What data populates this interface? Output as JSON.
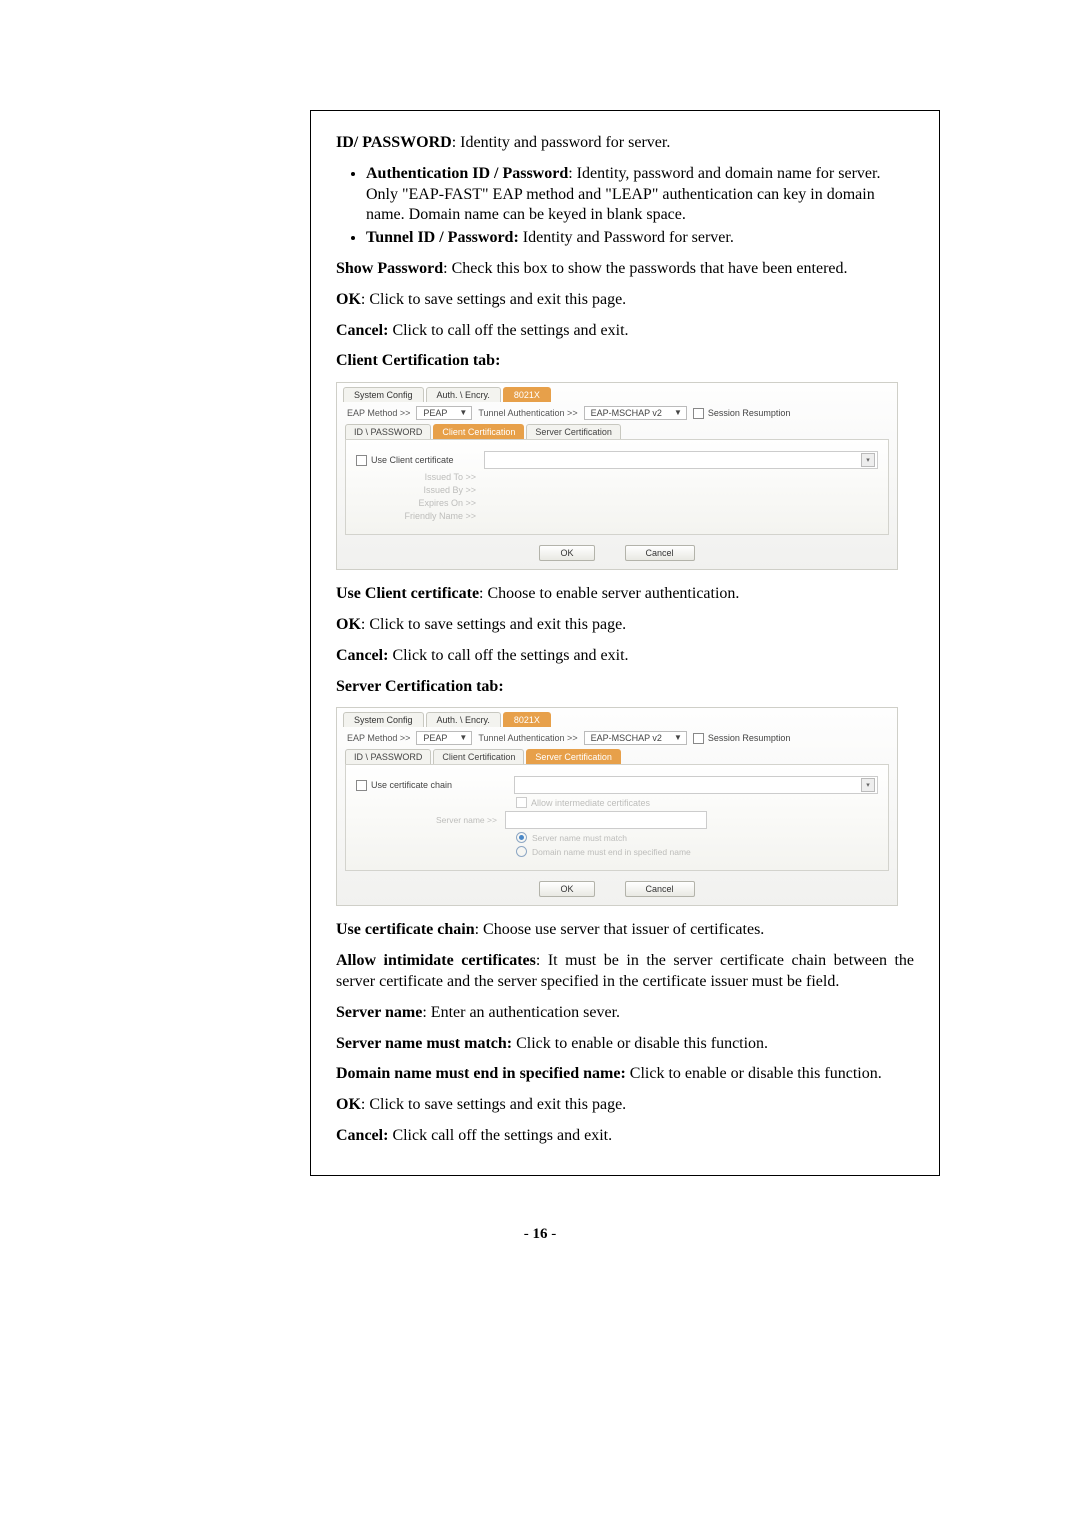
{
  "section1": {
    "heading_bold": "ID/ PASSWORD",
    "heading_rest": ": Identity and password for server.",
    "bullet1_bold": "Authentication ID / Password",
    "bullet1_rest": ": Identity, password and domain name for server. Only \"EAP-FAST\" EAP method and \"LEAP\" authentication can key in domain name. Domain name can be keyed in blank space.",
    "bullet2_bold": "Tunnel ID / Password:",
    "bullet2_rest": " Identity and Password for server.",
    "showpw_bold": "Show Password",
    "showpw_rest": ": Check this box to show the passwords that have been entered.",
    "ok_bold": "OK",
    "ok_rest": ": Click to save settings and exit this page.",
    "cancel_bold": "Cancel:",
    "cancel_rest": " Click to call off the settings and exit."
  },
  "client_tab_heading": "Client Certification tab:",
  "dlg": {
    "tabs": {
      "t1": "System Config",
      "t2": "Auth. \\ Encry.",
      "t3": "8021X"
    },
    "eap_label": "EAP Method >>",
    "eap_value": "PEAP",
    "tunnel_label": "Tunnel Authentication >>",
    "tunnel_value": "EAP-MSCHAP v2",
    "session_resumption": "Session Resumption",
    "subtabs": {
      "s1": "ID \\ PASSWORD",
      "s2": "Client Certification",
      "s3": "Server Certification"
    },
    "use_client_cert": "Use Client certificate",
    "issued_to": "Issued To >>",
    "issued_by": "Issued By >>",
    "expires_on": "Expires On >>",
    "friendly_name": "Friendly Name >>",
    "ok_btn": "OK",
    "cancel_btn": "Cancel"
  },
  "after_client": {
    "use_client_bold": "Use Client certificate",
    "use_client_rest": ": Choose to enable server authentication.",
    "ok_bold": "OK",
    "ok_rest": ": Click to save settings and exit this page.",
    "cancel_bold": "Cancel:",
    "cancel_rest": " Click to call off the settings and exit."
  },
  "server_tab_heading": "Server Certification tab:",
  "dlg2": {
    "use_cert_chain": "Use certificate chain",
    "allow_intermediate": "Allow intermediate certificates",
    "server_name_label": "Server name >>",
    "radio1": "Server name must match",
    "radio2": "Domain name must end in specified name"
  },
  "after_server": {
    "use_chain_bold": "Use certificate chain",
    "use_chain_rest": ": Choose use server that issuer of certificates.",
    "allow_bold": "Allow intimidate certificates",
    "allow_rest": ": It must be in the server certificate chain between the server certificate and the server specified in the certificate issuer must be field.",
    "server_name_bold": "Server name",
    "server_name_rest": ": Enter an authentication sever.",
    "match_bold": "Server name must match:",
    "match_rest": " Click to enable or disable this function.",
    "domain_bold": "Domain name must end in specified name:",
    "domain_rest": " Click to enable or disable this function.",
    "ok_bold": "OK",
    "ok_rest": ": Click to save settings and exit this page.",
    "cancel_bold": "Cancel:",
    "cancel_rest": " Click call off the settings and exit."
  },
  "page_number": "16"
}
